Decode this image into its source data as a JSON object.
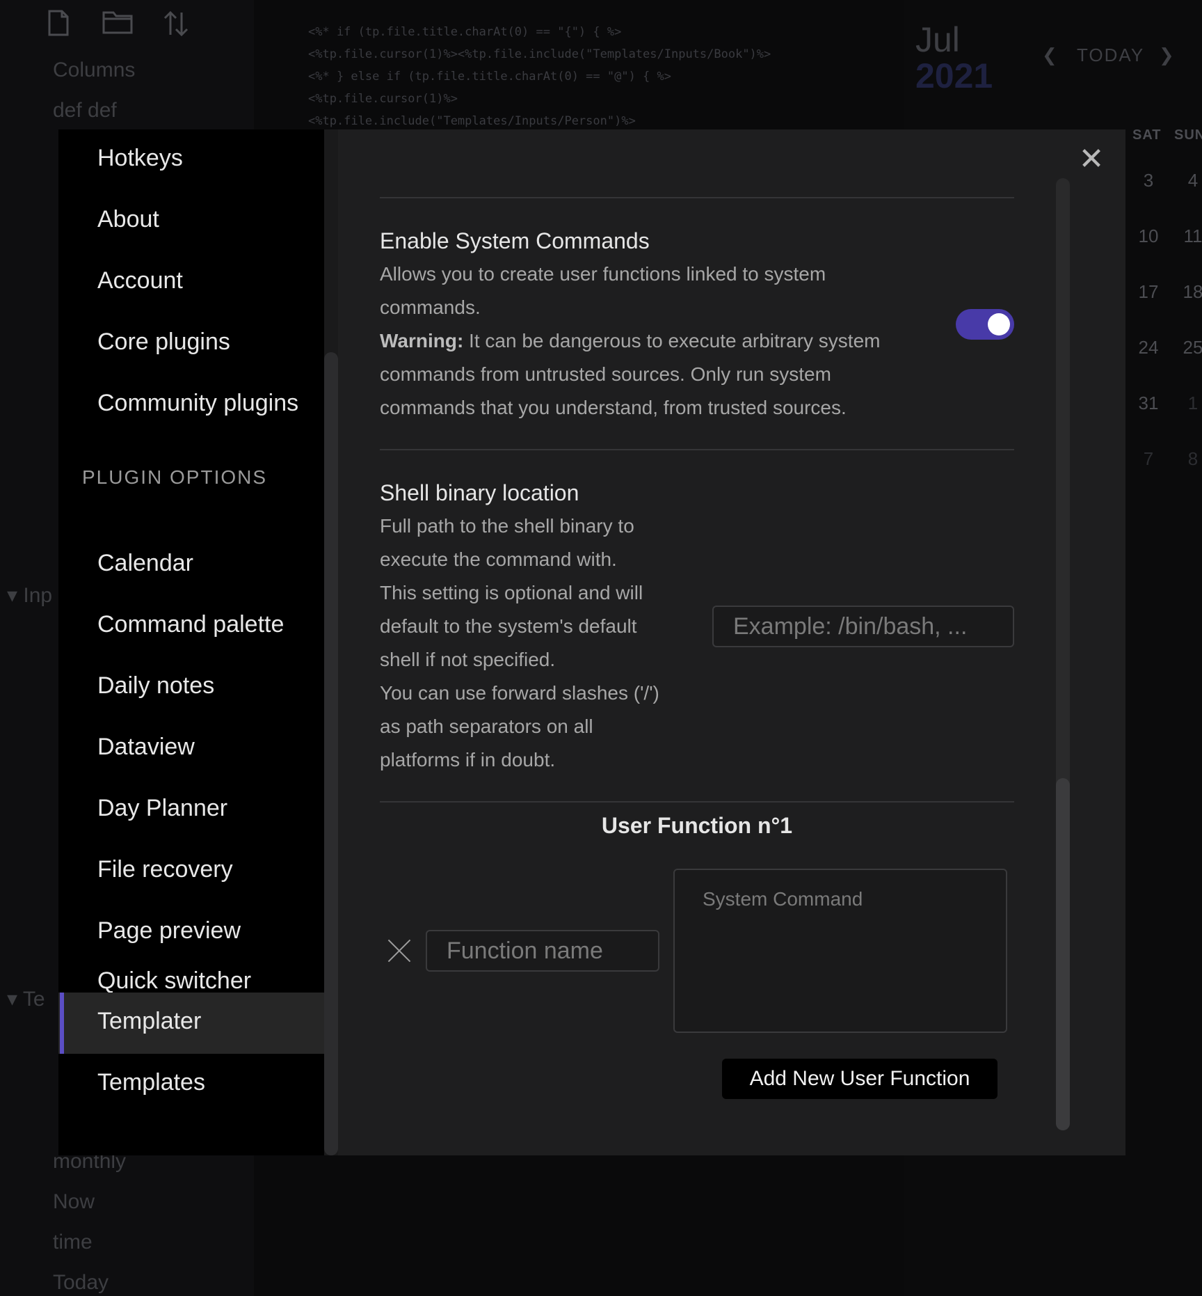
{
  "background": {
    "sidebar_files_top": [
      "Columns",
      "def def"
    ],
    "sidebar_files_bottom": [
      "monthly",
      "Now",
      "time",
      "Today"
    ],
    "sidebar_folders": [
      "Inp",
      "Te"
    ],
    "code_lines": [
      "<%* if (tp.file.title.charAt(0) == \"{\") { %>",
      "<%tp.file.cursor(1)%><%tp.file.include(\"Templates/Inputs/Book\")%>",
      "<%* } else if (tp.file.title.charAt(0) == \"@\") { %>",
      "<%tp.file.cursor(1)%>",
      "<%tp.file.include(\"Templates/Inputs/Person\")%>"
    ],
    "calendar": {
      "month": "Jul",
      "year": "2021",
      "today_label": "TODAY",
      "weekday_headers": [
        "SAT",
        "SUN"
      ],
      "weeks": [
        [
          "3",
          "4"
        ],
        [
          "10",
          "11"
        ],
        [
          "17",
          "18"
        ],
        [
          "24",
          "25"
        ],
        [
          "31",
          "1"
        ],
        [
          "7",
          "8"
        ]
      ]
    }
  },
  "settings_nav": {
    "items_top": [
      "Hotkeys",
      "About",
      "Account",
      "Core plugins",
      "Community plugins"
    ],
    "plugin_options_heading": "PLUGIN OPTIONS",
    "plugin_items": [
      "Calendar",
      "Command palette",
      "Daily notes",
      "Dataview",
      "Day Planner",
      "File recovery",
      "Page preview",
      "Quick switcher",
      "Templater",
      "Templates"
    ],
    "active_item": "Templater"
  },
  "content": {
    "system_commands": {
      "name": "Enable System Commands",
      "desc_line1": "Allows you to create user functions linked to system",
      "desc_line2": "commands.",
      "warning_label": "Warning:",
      "warning_line1": " It can be dangerous to execute arbitrary system",
      "warning_line2": "commands from untrusted sources. Only run system",
      "warning_line3": "commands that you understand, from trusted sources.",
      "enabled": true
    },
    "shell_binary": {
      "name": "Shell binary location",
      "desc_lines": [
        "Full path to the shell binary to",
        "execute the command with.",
        "This setting is optional and will",
        "default to the system's default",
        "shell if not specified.",
        "You can use forward slashes ('/')",
        "as path separators on all",
        "platforms if in doubt."
      ],
      "placeholder": "Example: /bin/bash, ...",
      "value": ""
    },
    "user_function": {
      "title": "User Function n°1",
      "name_placeholder": "Function name",
      "command_placeholder": "System Command"
    },
    "add_button_label": "Add New User Function"
  },
  "colors": {
    "accent": "#483aa8",
    "active_marker": "#5b4ec4",
    "modal_bg": "#1e1e1f",
    "nav_bg": "#000000"
  },
  "icons": {
    "close": "close-icon",
    "remove": "x-icon",
    "new_note": "new-note-icon",
    "new_folder": "new-folder-icon",
    "sort": "sort-icon",
    "prev": "chevron-left-icon",
    "next": "chevron-right-icon"
  }
}
